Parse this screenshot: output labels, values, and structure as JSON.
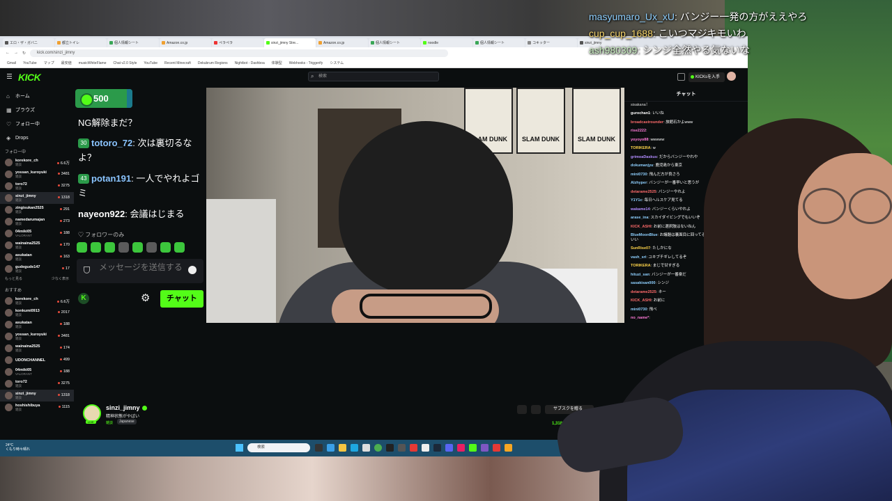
{
  "overlay_chat": [
    {
      "user": "masyumaro_Ux_xU",
      "text": "バンジー一発の方がええやろ"
    },
    {
      "user": "cup_cup_1688",
      "text": "こいつマジキモいわ"
    },
    {
      "user": "ash980309",
      "text": "シンジ全然やる気ないな"
    }
  ],
  "browser": {
    "url": "kick.com/sinzi_jimny",
    "active_tab": "sinzi_jimny Stre..."
  },
  "kick": {
    "logo": "KICK",
    "search_placeholder": "検索",
    "kicks_button": "KICKsを入手",
    "nav": [
      {
        "label": "ホーム",
        "icon": "home-icon"
      },
      {
        "label": "ブラウズ",
        "icon": "browse-icon"
      },
      {
        "label": "フォロー中",
        "icon": "heart-icon"
      },
      {
        "label": "Drops",
        "icon": "drops-icon"
      }
    ],
    "following_title": "フォロー中",
    "following": [
      {
        "name": "korekore_ch",
        "cat": "雑談",
        "viewers": "6.6万"
      },
      {
        "name": "yossan_kuroyuki",
        "cat": "雑談",
        "viewers": "3481"
      },
      {
        "name": "toro72",
        "cat": "雑談",
        "viewers": "3275"
      },
      {
        "name": "sinzi_jimny",
        "cat": "雑談",
        "viewers": "1318"
      },
      {
        "name": "zingisukan2525",
        "cat": "雑談",
        "viewers": "291"
      },
      {
        "name": "namedarumajan",
        "cat": "雑談",
        "viewers": "273"
      },
      {
        "name": "04miki05",
        "cat": "VALORANT",
        "viewers": "188"
      },
      {
        "name": "wainaina2525",
        "cat": "雑談",
        "viewers": "170"
      },
      {
        "name": "asukatan",
        "cat": "雑談",
        "viewers": "163"
      },
      {
        "name": "gudegude147",
        "cat": "雑談",
        "viewers": "17"
      }
    ],
    "show_more": "もっと見る",
    "show_less": "少なく表示",
    "recommended_title": "おすすめ",
    "recommended": [
      {
        "name": "korekore_ch",
        "cat": "雑談",
        "viewers": "6.6万"
      },
      {
        "name": "konkumi0913",
        "cat": "雑談",
        "viewers": "2017"
      },
      {
        "name": "asukatan",
        "cat": "雑談",
        "viewers": "188"
      },
      {
        "name": "yossan_kuroyuki",
        "cat": "雑談",
        "viewers": "3481"
      },
      {
        "name": "wainaina2525",
        "cat": "雑談",
        "viewers": "174"
      },
      {
        "name": "UDONCHANNEL",
        "cat": "",
        "viewers": "499"
      },
      {
        "name": "04miki05",
        "cat": "VALORANT",
        "viewers": "188"
      },
      {
        "name": "toro72",
        "cat": "雑談",
        "viewers": "3275"
      },
      {
        "name": "sinzi_jimny",
        "cat": "雑談",
        "viewers": "1318"
      },
      {
        "name": "hoshishibuya",
        "cat": "雑談",
        "viewers": "1115"
      }
    ]
  },
  "zoom_chat": {
    "points": "500",
    "messages": [
      {
        "badge": "",
        "user": "",
        "text": "NG解除まだ？"
      },
      {
        "badge": "30",
        "user": "totoro_72",
        "text": "次は裏切るなよ？"
      },
      {
        "badge": "43",
        "user": "potan191",
        "text": "一人でやれよゴミ"
      },
      {
        "badge": "",
        "user": "nayeon922",
        "text": "会議はじまる"
      }
    ],
    "followers_only": "♡ フォロワーのみ",
    "input_placeholder": "メッセージを送信する",
    "chat_button": "チャット"
  },
  "poster_text": [
    "SLAM DUNK",
    "SLAM DUNK",
    "SLAM DUNK"
  ],
  "stream": {
    "name": "sinzi_jimny",
    "title": "精神状態がやばい",
    "category": "雑談",
    "language": "Japanese",
    "live": "LIVE",
    "subscribe": "サブスクを贈る",
    "viewers": "1,318"
  },
  "right_chat": {
    "title": "チャット",
    "pinned": "sisakana！",
    "lines": [
      {
        "n": "gurochan1",
        "c": "#ffffff",
        "t": "いいね"
      },
      {
        "n": "broadcastrounder",
        "c": "#ff6b6b",
        "t": "旅館石かよwww"
      },
      {
        "n": "rise2222",
        "c": "#ff7ad9",
        "t": ""
      },
      {
        "n": "yoyoyo88",
        "c": "#ff7ad9",
        "t": "wwwww"
      },
      {
        "n": "TORIKERA",
        "c": "#ffd54a",
        "t": "w"
      },
      {
        "n": "grimoaDaskus",
        "c": "#b28cff",
        "t": "だからバンジーやれや"
      },
      {
        "n": "dokumanjyu",
        "c": "#8fd0ff",
        "t": "鹿児島から東京"
      },
      {
        "n": "mini0730",
        "c": "#8fd0ff",
        "t": "飛んだ方が良さろ"
      },
      {
        "n": "Alzhyper",
        "c": "#8fd0ff",
        "t": "バンジーが一番早いと思うが"
      },
      {
        "n": "detarame2525",
        "c": "#ff6b6b",
        "t": "バンジーやれよ"
      },
      {
        "n": "Y1Y1c",
        "c": "#8fd0ff",
        "t": "毎日ヘルスケア見てる"
      },
      {
        "n": "wakame14",
        "c": "#b28cff",
        "t": "バンジーくらいやれよ"
      },
      {
        "n": "arase_ina",
        "c": "#8fd0ff",
        "t": "スカイダイビングでもいいぞ"
      },
      {
        "n": "KICK_ASHI",
        "c": "#ff6b6b",
        "t": "お前に選択肢はないねん"
      },
      {
        "n": "BlueMoonBlue",
        "c": "#8fd0ff",
        "t": "お議題は裏面目に回ってる人が多いからやめた方がいい"
      },
      {
        "n": "SunRise07",
        "c": "#ffd54a",
        "t": "たしかにな"
      },
      {
        "n": "vash_sri",
        "c": "#8fd0ff",
        "t": "ユキブチギレしてるぞ"
      },
      {
        "n": "TORIKERA",
        "c": "#ffd54a",
        "t": "まじで甘すぎる"
      },
      {
        "n": "hituzi_san",
        "c": "#8fd0ff",
        "t": "バンジーが一番楽だ"
      },
      {
        "n": "sasakisan000",
        "c": "#8fd0ff",
        "t": "シンジ"
      },
      {
        "n": "detarame2525",
        "c": "#ff6b6b",
        "t": "ネー"
      },
      {
        "n": "KICK_ASHI",
        "c": "#ff6b6b",
        "t": "お前に"
      },
      {
        "n": "mini0730",
        "c": "#8fd0ff",
        "t": "飛べ"
      },
      {
        "n": "no_name*",
        "c": "#ff7ad9",
        "t": ""
      }
    ]
  },
  "taskbar": {
    "weather": "24°C",
    "weather_sub": "くもり時々晴れ",
    "search": "検索"
  }
}
